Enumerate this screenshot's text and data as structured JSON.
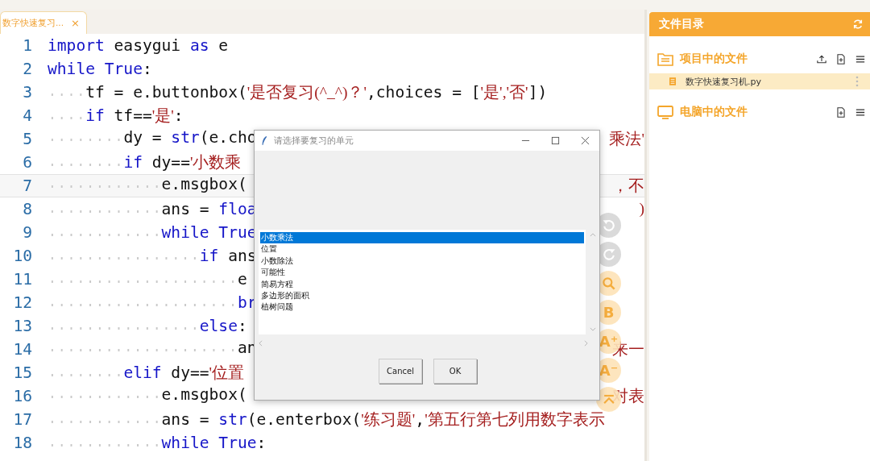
{
  "tab": {
    "label": "数字快速复习...",
    "close": "×"
  },
  "code": [
    {
      "number": "1",
      "current": false,
      "segments": [
        {
          "kind": "kw",
          "text": "import"
        },
        {
          "kind": "plain",
          "text": " easygui "
        },
        {
          "kind": "kw",
          "text": "as"
        },
        {
          "kind": "plain",
          "text": " e"
        }
      ]
    },
    {
      "number": "2",
      "current": false,
      "segments": [
        {
          "kind": "kw",
          "text": "while True"
        },
        {
          "kind": "plain",
          "text": ":"
        }
      ]
    },
    {
      "number": "3",
      "current": false,
      "segments": [
        {
          "kind": "plain",
          "text": "    tf = e.buttonbox("
        },
        {
          "kind": "str",
          "text": "'是否复习(^_^)？'"
        },
        {
          "kind": "plain",
          "text": ",choices = ["
        },
        {
          "kind": "str",
          "text": "'是','否'"
        },
        {
          "kind": "plain",
          "text": "])"
        }
      ]
    },
    {
      "number": "4",
      "current": false,
      "segments": [
        {
          "kind": "kw",
          "text": "    if"
        },
        {
          "kind": "plain",
          "text": " tf=="
        },
        {
          "kind": "str",
          "text": "'是'"
        },
        {
          "kind": "plain",
          "text": ":"
        }
      ]
    },
    {
      "number": "5",
      "current": false,
      "segments": [
        {
          "kind": "plain",
          "text": "        dy = "
        },
        {
          "kind": "kw",
          "text": "str"
        },
        {
          "kind": "plain",
          "text": "(e.cho"
        }
      ],
      "right": "乘法'"
    },
    {
      "number": "6",
      "current": false,
      "segments": [
        {
          "kind": "kw",
          "text": "        if"
        },
        {
          "kind": "plain",
          "text": " dy=="
        },
        {
          "kind": "str",
          "text": "'小数乘"
        }
      ]
    },
    {
      "number": "7",
      "current": true,
      "segments": [
        {
          "kind": "plain",
          "text": "            e.msgbox("
        }
      ],
      "right": "，不"
    },
    {
      "number": "8",
      "current": false,
      "segments": [
        {
          "kind": "plain",
          "text": "            ans = "
        },
        {
          "kind": "kw",
          "text": "floa"
        }
      ],
      "right": ")"
    },
    {
      "number": "9",
      "current": false,
      "segments": [
        {
          "kind": "kw",
          "text": "            while True"
        }
      ]
    },
    {
      "number": "10",
      "current": false,
      "segments": [
        {
          "kind": "kw",
          "text": "                if"
        },
        {
          "kind": "plain",
          "text": " ans"
        }
      ]
    },
    {
      "number": "11",
      "current": false,
      "segments": [
        {
          "kind": "plain",
          "text": "                    e"
        }
      ]
    },
    {
      "number": "12",
      "current": false,
      "segments": [
        {
          "kind": "kw",
          "text": "                    br"
        }
      ]
    },
    {
      "number": "13",
      "current": false,
      "segments": [
        {
          "kind": "kw",
          "text": "                else"
        },
        {
          "kind": "plain",
          "text": ":"
        }
      ]
    },
    {
      "number": "14",
      "current": false,
      "segments": [
        {
          "kind": "plain",
          "text": "                    an"
        }
      ],
      "right": "来一"
    },
    {
      "number": "15",
      "current": false,
      "segments": [
        {
          "kind": "kw",
          "text": "        elif"
        },
        {
          "kind": "plain",
          "text": " dy=="
        },
        {
          "kind": "str",
          "text": "'位置"
        }
      ]
    },
    {
      "number": "16",
      "current": false,
      "segments": [
        {
          "kind": "plain",
          "text": "            e.msgbox("
        }
      ],
      "right": "对表"
    },
    {
      "number": "17",
      "current": false,
      "segments": [
        {
          "kind": "plain",
          "text": "            ans = "
        },
        {
          "kind": "kw",
          "text": "str"
        },
        {
          "kind": "plain",
          "text": "(e.enterbox("
        },
        {
          "kind": "str",
          "text": "'练习题'"
        },
        {
          "kind": "plain",
          "text": ","
        },
        {
          "kind": "str",
          "text": "'第五行第七列用数字表示"
        }
      ]
    },
    {
      "number": "18",
      "current": false,
      "segments": [
        {
          "kind": "kw",
          "text": "            while True"
        },
        {
          "kind": "plain",
          "text": ":"
        }
      ]
    }
  ],
  "tools": [
    {
      "kind": "undo",
      "disabled": true
    },
    {
      "kind": "redo",
      "disabled": true
    },
    {
      "kind": "search",
      "disabled": false
    },
    {
      "kind": "text",
      "label": "B",
      "disabled": false
    },
    {
      "kind": "text",
      "label": "A⁺",
      "disabled": false
    },
    {
      "kind": "text",
      "label": "A⁻",
      "disabled": false
    },
    {
      "kind": "up",
      "disabled": false
    }
  ],
  "dialog": {
    "title": "请选择要复习的单元",
    "items": [
      {
        "label": "小数乘法",
        "selected": true
      },
      {
        "label": "位置",
        "selected": false
      },
      {
        "label": "小数除法",
        "selected": false
      },
      {
        "label": "可能性",
        "selected": false
      },
      {
        "label": "简易方程",
        "selected": false
      },
      {
        "label": "多边形的面积",
        "selected": false
      },
      {
        "label": "植树问题",
        "selected": false
      }
    ],
    "buttons": [
      "Cancel",
      "OK"
    ]
  },
  "sidebar": {
    "title": "文件目录",
    "sections": [
      {
        "kind": "project",
        "label": "项目中的文件",
        "files": [
          {
            "name": "数字快速复习机.py",
            "selected": true
          }
        ]
      },
      {
        "kind": "computer",
        "label": "电脑中的文件"
      }
    ]
  }
}
